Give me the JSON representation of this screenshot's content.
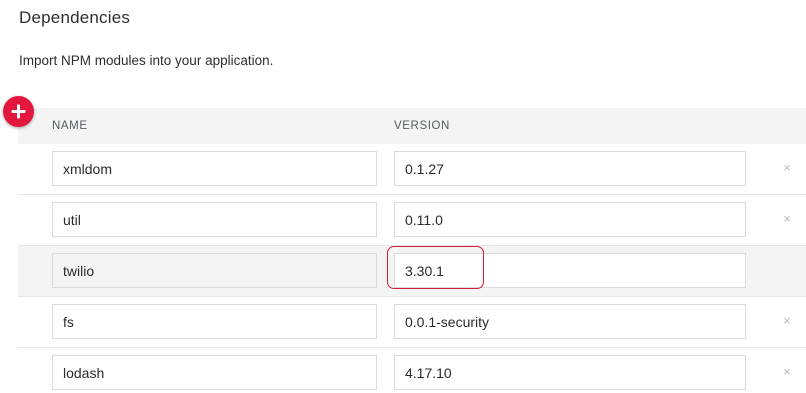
{
  "header": {
    "title": "Dependencies",
    "description": "Import NPM modules into your application."
  },
  "table": {
    "columns": {
      "name": "NAME",
      "version": "VERSION"
    },
    "rows": [
      {
        "name": "xmldom",
        "version": "0.1.27",
        "removable": true
      },
      {
        "name": "util",
        "version": "0.11.0",
        "removable": true
      },
      {
        "name": "twilio",
        "version": "3.30.1",
        "removable": false
      },
      {
        "name": "fs",
        "version": "0.0.1-security",
        "removable": true
      },
      {
        "name": "lodash",
        "version": "4.17.10",
        "removable": true
      }
    ],
    "remove_glyph": "×"
  },
  "icons": {
    "add": "plus-icon",
    "remove": "close-icon"
  },
  "colors": {
    "accent": "#e3173e",
    "highlight": "#d61f3c",
    "header_bg": "#f4f4f5"
  }
}
